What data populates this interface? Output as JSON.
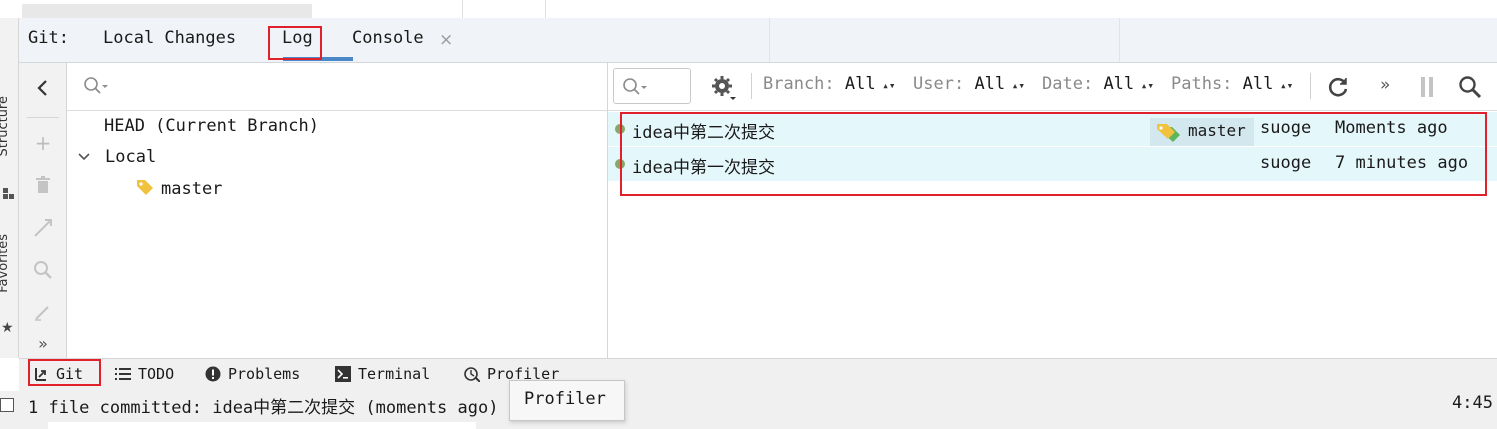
{
  "tool_window": {
    "prefix": "Git:",
    "tabs": [
      {
        "label": "Local Changes",
        "active": false
      },
      {
        "label": "Log",
        "active": true
      },
      {
        "label": "Console",
        "active": false,
        "closable": true
      }
    ],
    "close_glyph": "×"
  },
  "side_tabs": {
    "structure": "Structure",
    "favorites": "Favorites"
  },
  "branches": {
    "head_label": "HEAD (Current Branch)",
    "local_label": "Local",
    "local_branches": [
      "master"
    ]
  },
  "log_toolbar": {
    "filters": [
      {
        "name": "Branch:",
        "value": "All"
      },
      {
        "name": "User:",
        "value": "All"
      },
      {
        "name": "Date:",
        "value": "All"
      },
      {
        "name": "Paths:",
        "value": "All"
      }
    ],
    "more_glyph": "»"
  },
  "commits": [
    {
      "message": "idea中第二次提交",
      "ref": "master",
      "author": "suoge",
      "date": "Moments ago"
    },
    {
      "message": "idea中第一次提交",
      "ref": "",
      "author": "suoge",
      "date": "7 minutes ago"
    }
  ],
  "bottom_tools": [
    {
      "label": "Git"
    },
    {
      "label": "TODO"
    },
    {
      "label": "Problems"
    },
    {
      "label": "Terminal"
    },
    {
      "label": "Profiler"
    }
  ],
  "status": {
    "message": "1 file committed: idea中第二次提交 (moments ago)",
    "time": "4:45"
  },
  "tooltip": {
    "text": "Profiler"
  },
  "colors": {
    "accent_underline": "#4a88c7",
    "highlight_box": "#e0202a",
    "commit_row_bg": "#e4f7fb",
    "graph_node": "#8aa56a",
    "tag_yellow": "#f0c23e",
    "tag_green": "#5cb65c"
  }
}
